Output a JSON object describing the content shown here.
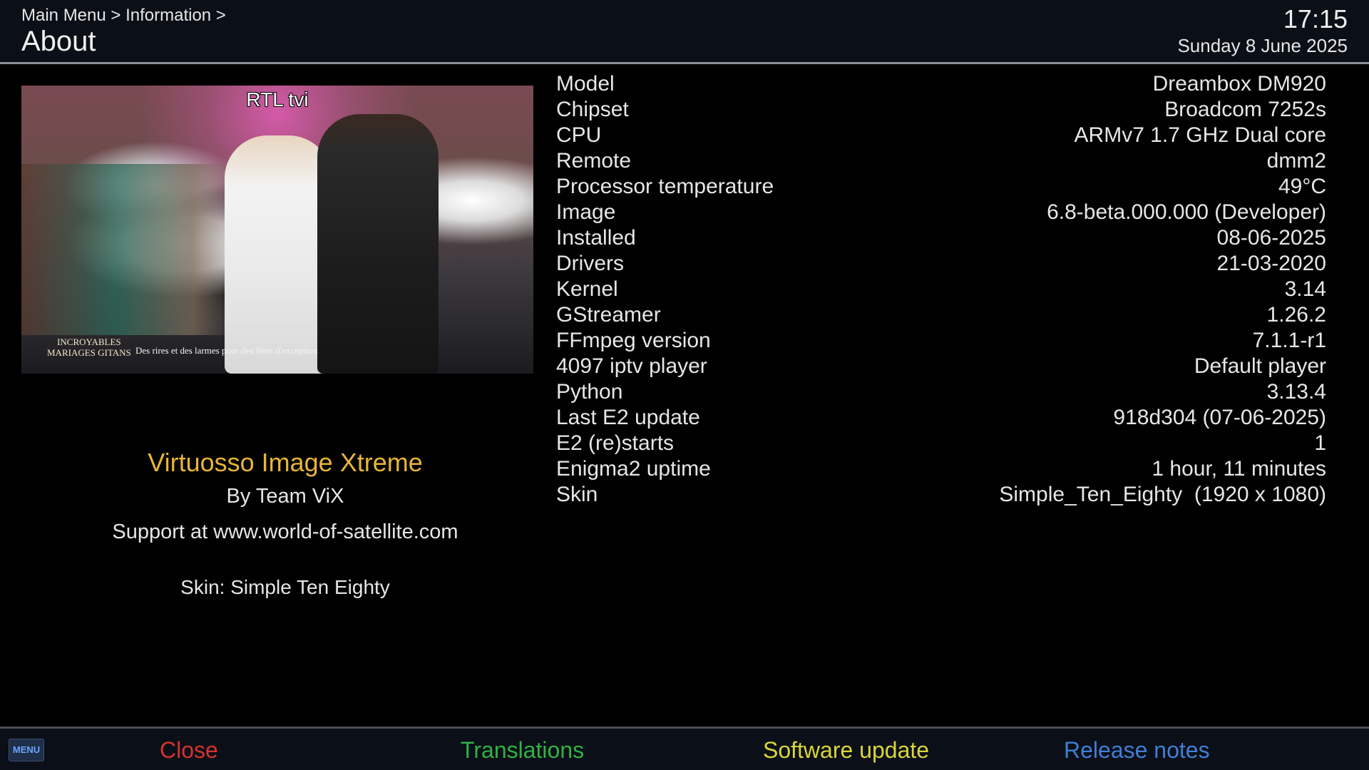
{
  "header": {
    "breadcrumb": "Main Menu > Information >",
    "title": "About",
    "time": "17:15",
    "date": "Sunday 8 June 2025"
  },
  "preview": {
    "channel_logo": "RTL tvi",
    "show_logo_line1": "INCROYABLES",
    "show_logo_line2": "MARIAGES GITANS",
    "subtitle": "Des rires et des larmes pour des fêtes d'exception"
  },
  "image_info": {
    "name": "Virtuosso Image Xtreme",
    "byline": "By Team ViX",
    "support": "Support at www.world-of-satellite.com",
    "skin": "Skin: Simple Ten Eighty"
  },
  "info_rows": [
    {
      "label": "Model",
      "value": "Dreambox DM920"
    },
    {
      "label": "Chipset",
      "value": "Broadcom 7252s"
    },
    {
      "label": "CPU",
      "value": "ARMv7 1.7 GHz Dual core"
    },
    {
      "label": "Remote",
      "value": "dmm2"
    },
    {
      "label": "Processor temperature",
      "value": "49°C"
    },
    {
      "label": "Image",
      "value": "6.8-beta.000.000 (Developer)"
    },
    {
      "label": "Installed",
      "value": "08-06-2025"
    },
    {
      "label": "Drivers",
      "value": "21-03-2020"
    },
    {
      "label": "Kernel",
      "value": "3.14"
    },
    {
      "label": "GStreamer",
      "value": "1.26.2"
    },
    {
      "label": "FFmpeg version",
      "value": "7.1.1-r1"
    },
    {
      "label": "4097 iptv player",
      "value": "Default player"
    },
    {
      "label": "Python",
      "value": "3.13.4"
    },
    {
      "label": "Last E2 update",
      "value": "918d304 (07-06-2025)"
    },
    {
      "label": "E2 (re)starts",
      "value": "1"
    },
    {
      "label": "Enigma2 uptime",
      "value": "1 hour, 11 minutes"
    },
    {
      "label": "Skin",
      "value": "Simple_Ten_Eighty  (1920 x 1080)"
    }
  ],
  "footer": {
    "menu_key": "MENU",
    "red": "Close",
    "green": "Translations",
    "yellow": "Software update",
    "blue": "Release notes"
  },
  "colors": {
    "red": "#d6322e",
    "green": "#2fb344",
    "yellow": "#d9d53a",
    "blue": "#3f7fd6",
    "accent_title": "#e8b53a"
  }
}
